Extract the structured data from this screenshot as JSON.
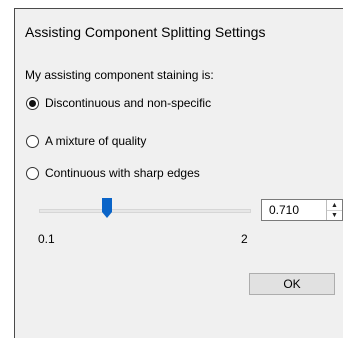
{
  "dialog": {
    "title": "Assisting Component Splitting Settings"
  },
  "staining": {
    "label": "My assisting component staining is:",
    "options": [
      {
        "label": "Discontinuous and non-specific",
        "selected": true
      },
      {
        "label": "A mixture of quality",
        "selected": false
      },
      {
        "label": "Continuous with sharp edges",
        "selected": false
      }
    ]
  },
  "slider": {
    "min_label": "0.1",
    "max_label": "2",
    "value": 0.71,
    "min": 0.1,
    "max": 2,
    "thumb_color": "#0a64c8"
  },
  "spinbox": {
    "value": "0.710",
    "up_icon": "arrow-up-icon",
    "down_icon": "arrow-down-icon"
  },
  "buttons": {
    "ok_label": "OK"
  }
}
